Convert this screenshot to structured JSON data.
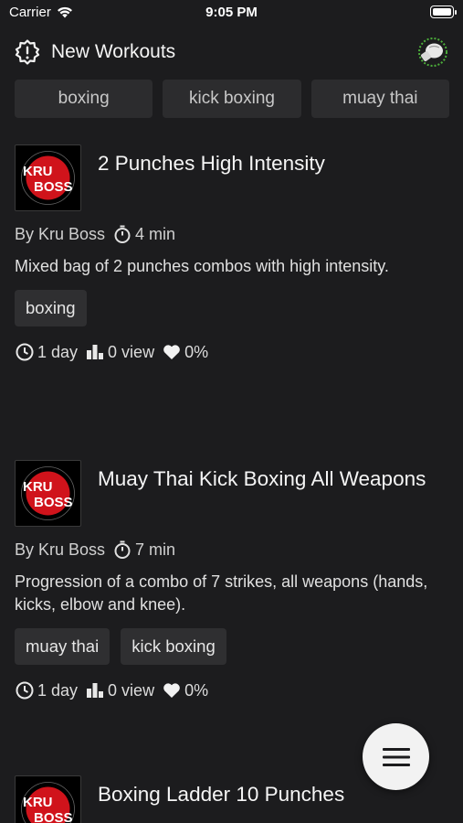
{
  "status_bar": {
    "carrier": "Carrier",
    "time": "9:05 PM"
  },
  "header": {
    "title": "New Workouts"
  },
  "filters": [
    "boxing",
    "kick boxing",
    "muay thai"
  ],
  "workouts": [
    {
      "title": "2 Punches High Intensity",
      "author": "By Kru Boss",
      "duration": "4 min",
      "description": "Mixed bag of 2 punches combos with high intensity.",
      "tags": [
        "boxing"
      ],
      "age": "1 day",
      "views": "0 view",
      "likes": "0%"
    },
    {
      "title": "Muay Thai Kick Boxing All Weapons",
      "author": "By Kru Boss",
      "duration": "7 min",
      "description": "Progression of a combo of 7 strikes, all weapons (hands, kicks, elbow and knee).",
      "tags": [
        "muay thai",
        "kick boxing"
      ],
      "age": "1 day",
      "views": "0 view",
      "likes": "0%"
    },
    {
      "title": "Boxing Ladder 10 Punches"
    }
  ],
  "brand": {
    "logo_line1": "KRU",
    "logo_line2": "BOSS"
  },
  "colors": {
    "background": "#1c1c1e",
    "chip": "#2c2c2e",
    "logo_red": "#d0131b",
    "fab": "#f2f2f2"
  }
}
